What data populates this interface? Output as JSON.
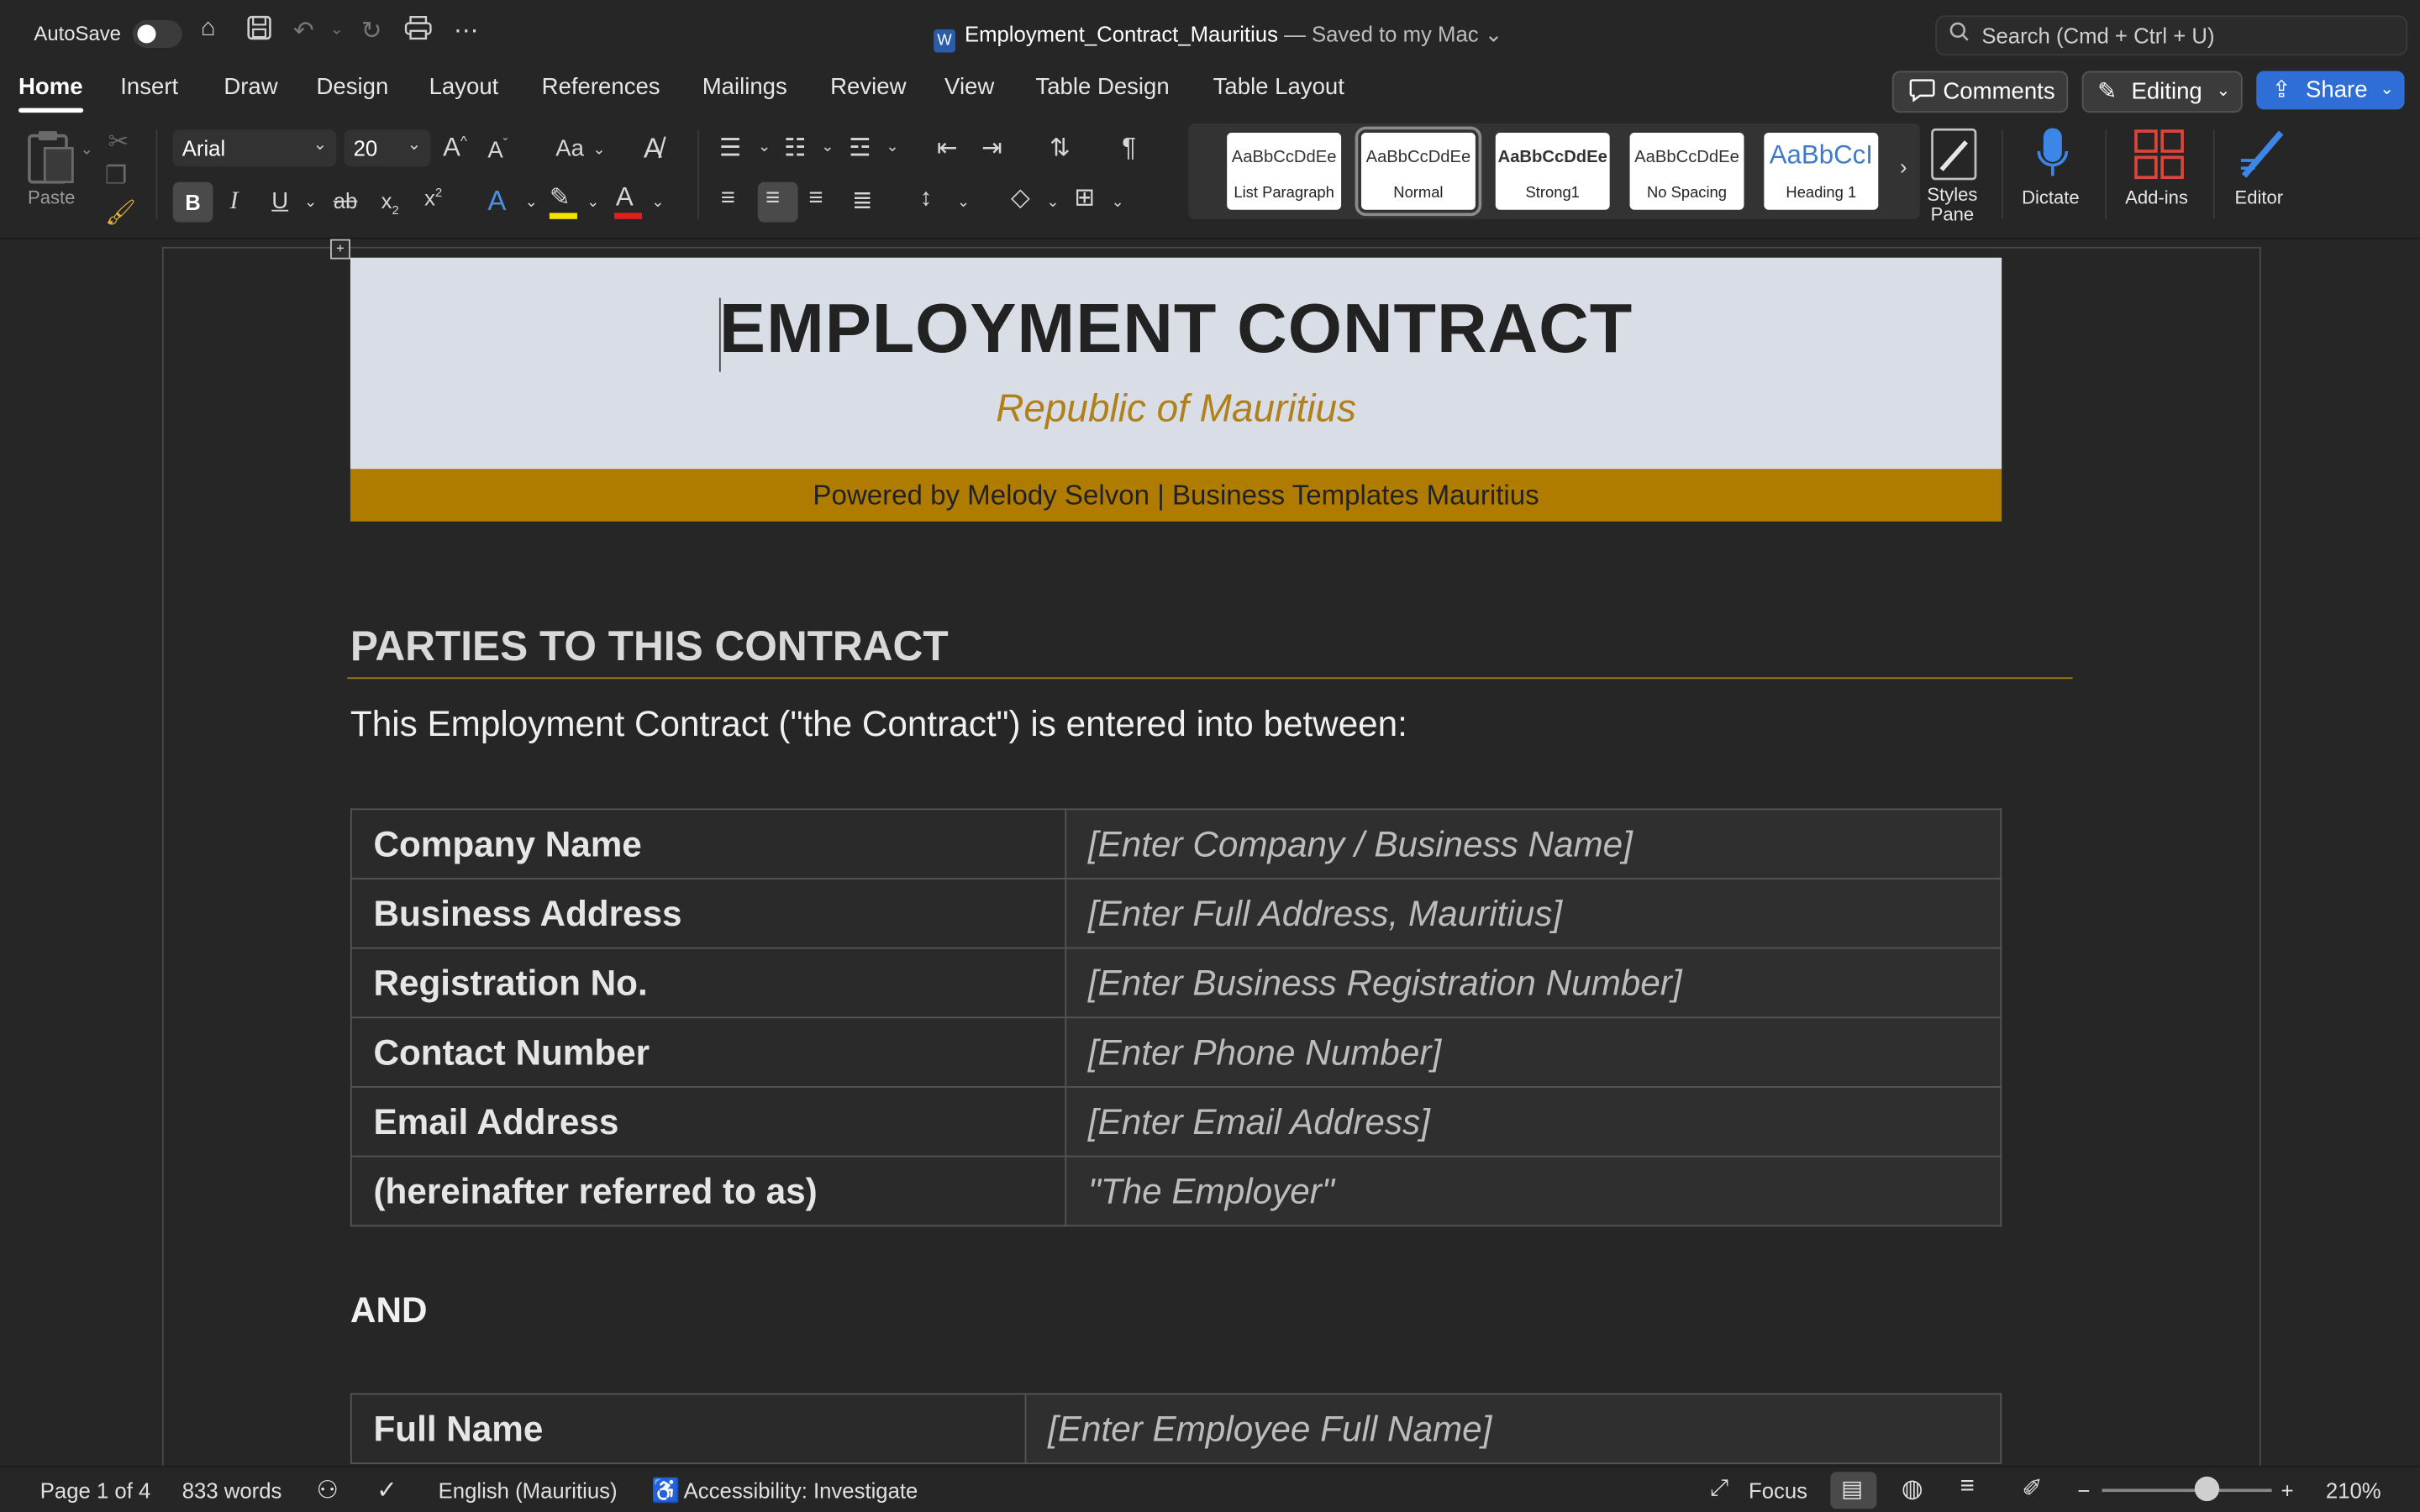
{
  "titlebar": {
    "autosave_label": "AutoSave",
    "doc_name": "Employment_Contract_Mauritius",
    "saved_status": " — Saved to my Mac",
    "search_placeholder": "Search (Cmd + Ctrl + U)"
  },
  "tabs": [
    "Home",
    "Insert",
    "Draw",
    "Design",
    "Layout",
    "References",
    "Mailings",
    "Review",
    "View",
    "Table Design",
    "Table Layout"
  ],
  "top_buttons": {
    "comments": "Comments",
    "editing": "Editing",
    "share": "Share"
  },
  "ribbon": {
    "paste_label": "Paste",
    "font_name": "Arial",
    "font_size": "20",
    "styles": [
      {
        "sample": "AaBbCcDdEe",
        "name": "List Paragraph"
      },
      {
        "sample": "AaBbCcDdEe",
        "name": "Normal"
      },
      {
        "sample": "AaBbCcDdEe",
        "name": "Strong1"
      },
      {
        "sample": "AaBbCcDdEe",
        "name": "No Spacing"
      },
      {
        "sample": "AaBbCcI",
        "name": "Heading 1"
      }
    ],
    "styles_pane": "Styles Pane",
    "dictate": "Dictate",
    "addins": "Add-ins",
    "editor": "Editor"
  },
  "document": {
    "title": "EMPLOYMENT CONTRACT",
    "subtitle": "Republic of Mauritius",
    "powered_by": "Powered by Melody Selvon  |  Business Templates Mauritius",
    "section_heading": "PARTIES TO THIS CONTRACT",
    "intro": "This Employment Contract (\"the Contract\") is entered into between:",
    "employer_rows": [
      {
        "label": "Company Name",
        "value": "[Enter Company / Business Name]"
      },
      {
        "label": "Business Address",
        "value": "[Enter Full Address, Mauritius]"
      },
      {
        "label": "Registration No.",
        "value": "[Enter Business Registration Number]"
      },
      {
        "label": "Contact Number",
        "value": "[Enter Phone Number]"
      },
      {
        "label": "Email Address",
        "value": "[Enter Email Address]"
      },
      {
        "label": "(hereinafter referred to as)",
        "value": "\"The Employer\""
      }
    ],
    "and_label": "AND",
    "employee_rows": [
      {
        "label": "Full Name",
        "value": "[Enter Employee Full Name]"
      }
    ]
  },
  "statusbar": {
    "page": "Page 1 of 4",
    "words": "833 words",
    "language": "English (Mauritius)",
    "accessibility": "Accessibility: Investigate",
    "focus": "Focus",
    "zoom": "210%",
    "zoom_level_percent": 210
  }
}
